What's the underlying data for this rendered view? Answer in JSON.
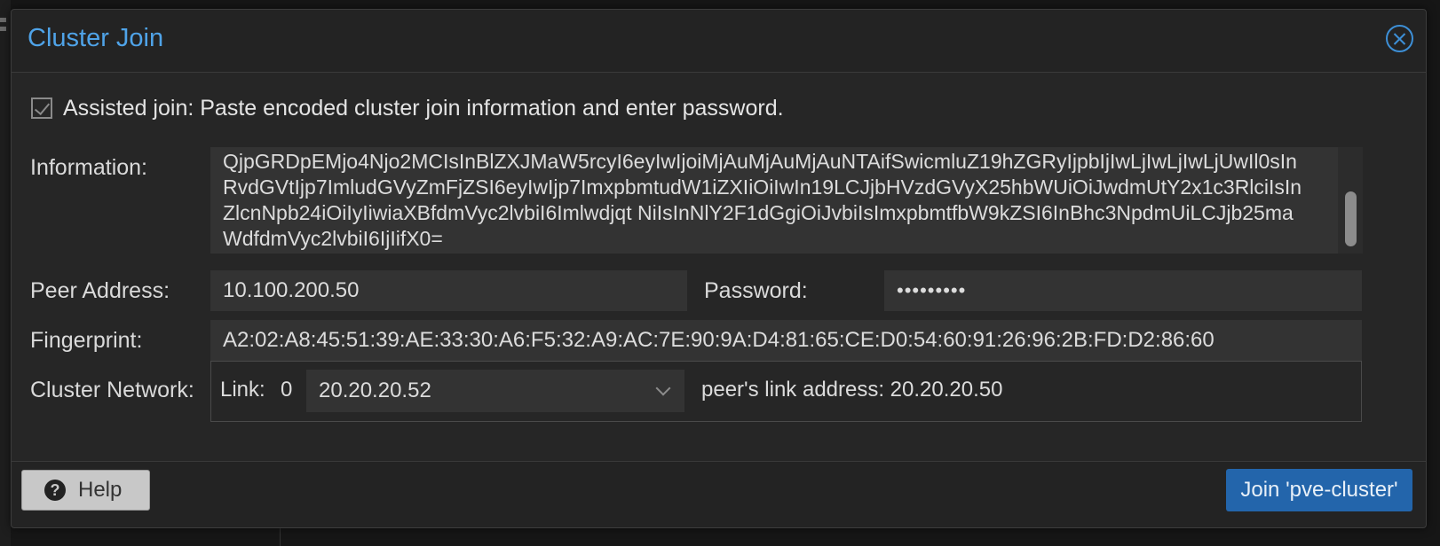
{
  "dialog": {
    "title": "Cluster Join"
  },
  "assisted_join": {
    "checked": true,
    "label": "Assisted join: Paste encoded cluster join information and enter password."
  },
  "information": {
    "label": "Information:",
    "value": "QjpGRDpEMjo4Njo2MCIsInBlZXJMaW5rcyI6eyIwIjoiMjAuMjAuMjAuNTAifSwicmluZ19hZGRyIjpbIjIwLjIwLjIwLjUwIl0sInRvdGVtIjp7ImludGVyZmFjZSI6eyIwIjp7ImxpbmtudW1iZXIiOiIwIn19LCJjbHVzdGVyX25hbWUiOiJwdmUtY2x1c3RlciIsInZlcnNpb24iOiIyIiwiaXBfdmVyc2lvbiI6Imlwdjqt NiIsInNlY2F1dGgiOiJvbiIsImxpbmtfbW9kZSI6InBhc3NpdmUiLCJjb25maWdfdmVyc2lvbiI6IjIifX0="
  },
  "peer_address": {
    "label": "Peer Address:",
    "value": "10.100.200.50"
  },
  "password": {
    "label": "Password:",
    "value": "•••••••••"
  },
  "fingerprint": {
    "label": "Fingerprint:",
    "value": "A2:02:A8:45:51:39:AE:33:30:A6:F5:32:A9:AC:7E:90:9A:D4:81:65:CE:D0:54:60:91:26:96:2B:FD:D2:86:60"
  },
  "cluster_network": {
    "label": "Cluster Network:",
    "link_label": "Link:",
    "link_index": "0",
    "link_address": "20.20.20.52",
    "peer_link_text": "peer's link address: 20.20.20.50"
  },
  "footer": {
    "help_label": "Help",
    "join_label": "Join 'pve-cluster'"
  },
  "colors": {
    "accent": "#4fa3e8",
    "primary_button": "#2365ab",
    "dialog_bg": "#232323"
  }
}
